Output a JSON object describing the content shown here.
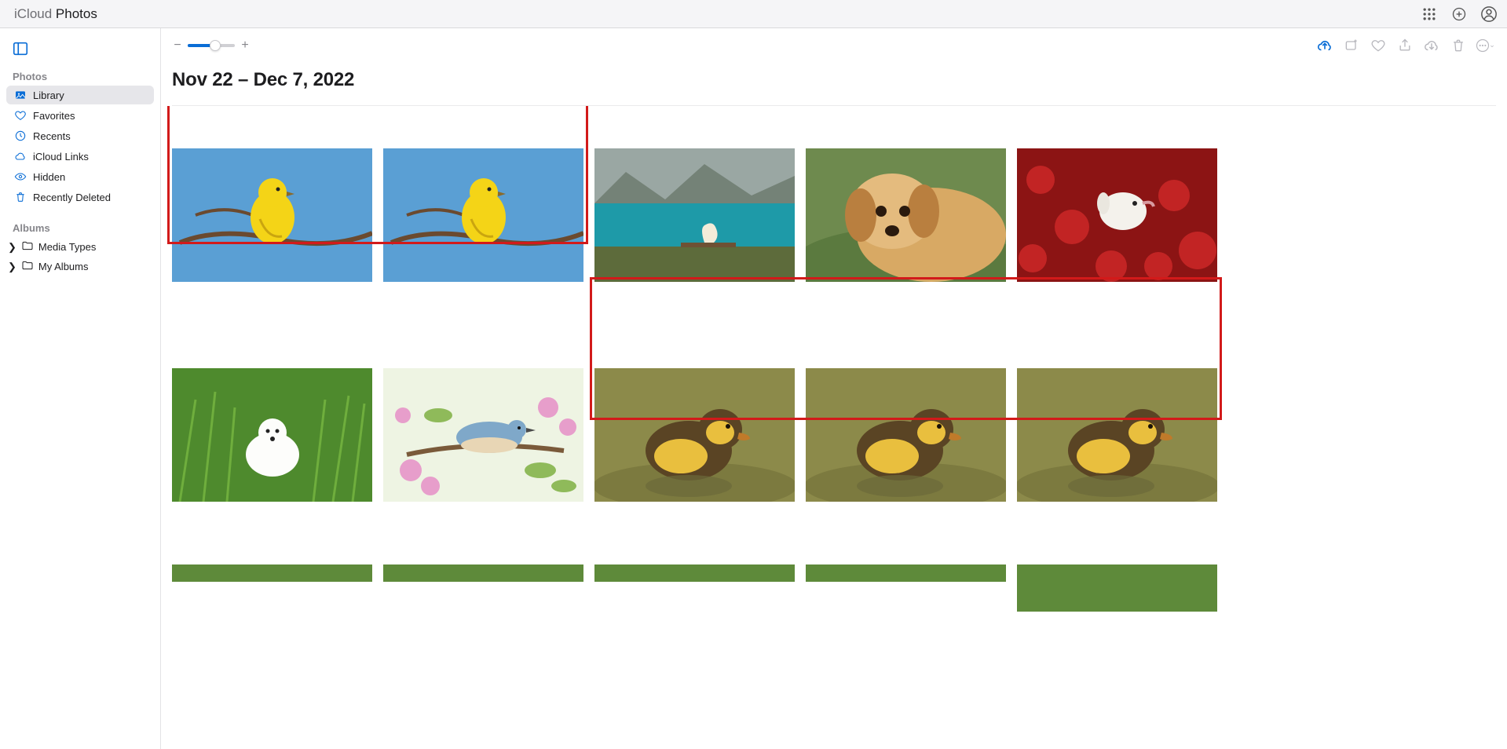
{
  "topbar": {
    "brand_prefix": "iCloud ",
    "brand_strong": "Photos"
  },
  "sidebar": {
    "section_photos": "Photos",
    "section_albums": "Albums",
    "items": [
      {
        "label": "Library"
      },
      {
        "label": "Favorites"
      },
      {
        "label": "Recents"
      },
      {
        "label": "iCloud Links"
      },
      {
        "label": "Hidden"
      },
      {
        "label": "Recently Deleted"
      }
    ],
    "album_groups": [
      {
        "label": "Media Types"
      },
      {
        "label": "My Albums"
      }
    ]
  },
  "content": {
    "date_range": "Nov 22 – Dec 7, 2022",
    "zoom": {
      "percent": 58
    }
  },
  "photos": {
    "row1": [
      {
        "name": "yellow-bird-on-branch-1",
        "kind": "yellowbird"
      },
      {
        "name": "yellow-bird-on-branch-2",
        "kind": "yellowbird"
      },
      {
        "name": "dog-at-mountain-lake",
        "kind": "lake"
      },
      {
        "name": "golden-retriever-puppy",
        "kind": "puppy"
      },
      {
        "name": "white-dog-in-red-flowers",
        "kind": "redflowers"
      }
    ],
    "row2": [
      {
        "name": "white-dog-in-grass",
        "kind": "grassdog"
      },
      {
        "name": "blue-bird-blossoms",
        "kind": "bluebird"
      },
      {
        "name": "duckling-1",
        "kind": "duckling"
      },
      {
        "name": "duckling-2",
        "kind": "duckling"
      },
      {
        "name": "duckling-3",
        "kind": "duckling"
      }
    ]
  },
  "highlights": [
    {
      "row": 1,
      "from": 0,
      "to": 1
    },
    {
      "row": 2,
      "from": 2,
      "to": 4
    }
  ]
}
